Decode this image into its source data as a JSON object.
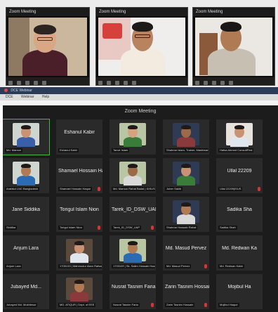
{
  "top": {
    "panels": [
      {
        "title": "Zoom Meeting"
      },
      {
        "title": "Zoom Meeting"
      },
      {
        "title": "Zoom Meeting"
      }
    ],
    "browser_tab": "DCE Webinar",
    "menu_items": [
      "DCE",
      "Webinar",
      "Help"
    ]
  },
  "meeting": {
    "title": "Zoom Meeting",
    "tiles": [
      {
        "name": "",
        "tag": "Md. Mamun",
        "video": true,
        "active": true,
        "mic": false
      },
      {
        "name": "Eshanul Kabir",
        "tag": "Eshanul Kabir",
        "video": false,
        "mic": false
      },
      {
        "name": "",
        "tag": "Tanvir Islam",
        "video": true,
        "mic": false
      },
      {
        "name": "",
        "tag": "Shahriar Islam, Trainer, Mashiwari P...",
        "video": true,
        "mic": false
      },
      {
        "name": "",
        "tag": "Hafsa Ahmed ConsultFirst",
        "video": true,
        "mic": false
      },
      {
        "name": "",
        "tag": "Arafatul LNC Bangladesh",
        "video": true,
        "mic": false
      },
      {
        "name": "Shamael Hossain Ha...",
        "tag": "Shamael Hossain Haque",
        "video": false,
        "mic": true
      },
      {
        "name": "",
        "tag": "Md. Mamun Rahat Badal | IDSUS",
        "video": true,
        "mic": false
      },
      {
        "name": "",
        "tag": "Juber Sakib",
        "video": true,
        "mic": false
      },
      {
        "name": "Ullal 22209",
        "tag": "Ullal 22209|ISUS",
        "video": false,
        "mic": true
      },
      {
        "name": "Jane Siddika",
        "tag": "Siddika",
        "video": false,
        "mic": false
      },
      {
        "name": "Torigul Islam Nion",
        "tag": "Torigul Islam Nion",
        "video": false,
        "mic": true
      },
      {
        "name": "Tarek_ID_DSW_UAP",
        "tag": "Tarek_ID_DSW_UAP",
        "video": false,
        "mic": true
      },
      {
        "name": "",
        "tag": "Shahriar Hossain Rahat",
        "video": true,
        "mic": false
      },
      {
        "name": "Sadika Sha",
        "tag": "Sadika Shah",
        "video": false,
        "mic": false
      },
      {
        "name": "Anjum Lara",
        "tag": "Anjum Lara",
        "video": false,
        "mic": false
      },
      {
        "name": "",
        "tag": "1705133 | Mahmudur Alam Rafsan",
        "video": true,
        "mic": false
      },
      {
        "name": "",
        "tag": "1703109 | Sk. Salim Hossain Hazari",
        "video": true,
        "mic": false
      },
      {
        "name": "Md. Masud Pervez",
        "tag": "Md. Masud Pervez",
        "video": false,
        "mic": true
      },
      {
        "name": "Md. Redwan Ka",
        "tag": "Md. Redwan Kabir",
        "video": false,
        "mic": false
      },
      {
        "name": "Jubayed Md...",
        "tag": "Jubayed Md. Mokhlesur",
        "video": false,
        "mic": false
      },
      {
        "name": "",
        "tag": "MD. ATIQUR | Dept. of EEE",
        "video": true,
        "mic": false
      },
      {
        "name": "Nusrat Tasnim Faria",
        "tag": "Nusrat Tasnim Faria",
        "video": false,
        "mic": true
      },
      {
        "name": "Zarin Tasnim Hossain",
        "tag": "Zarin Tasnim Hossain",
        "video": false,
        "mic": true
      },
      {
        "name": "Mojibul Ha",
        "tag": "Mojibul Haque",
        "video": false,
        "mic": false
      }
    ]
  }
}
